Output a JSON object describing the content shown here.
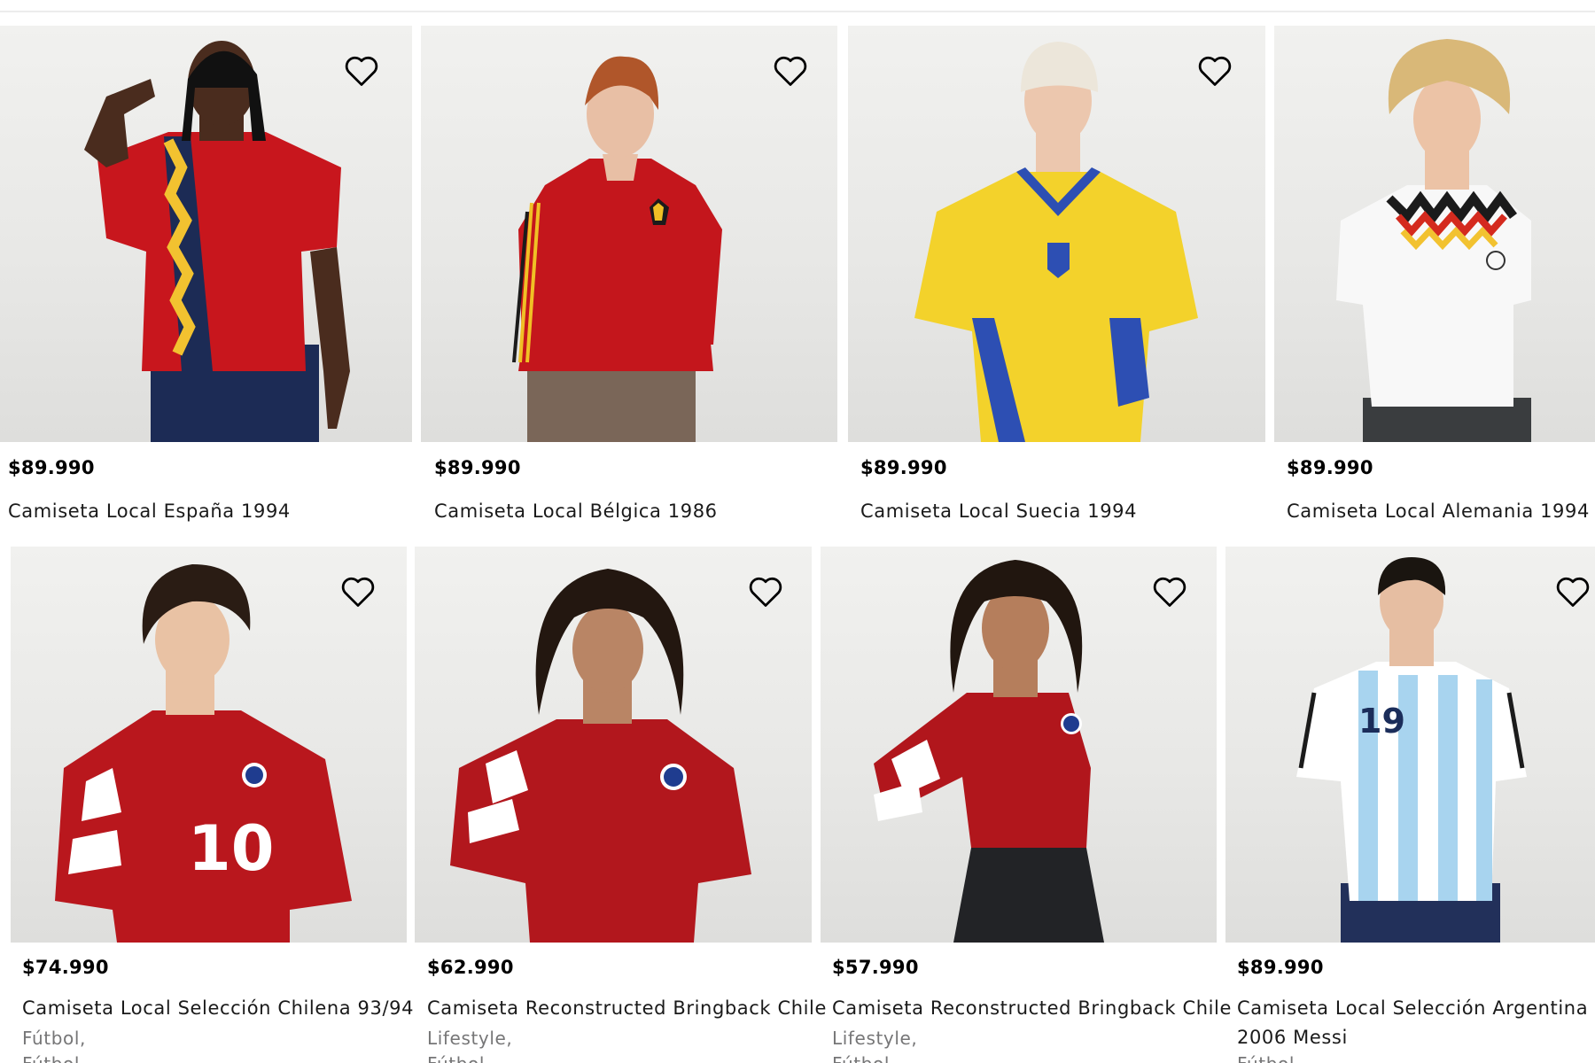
{
  "products": [
    {
      "price": "$89.990",
      "name": "Camiseta Local España 1994",
      "colors": {
        "shirt": "#c8161d",
        "accent": "#f2c230",
        "bottom": "#1c2b55",
        "skin": "#4a2c1e",
        "hair": "#111111"
      }
    },
    {
      "price": "$89.990",
      "name": "Camiseta Local Bélgica 1986",
      "colors": {
        "shirt": "#c4161c",
        "accent": "#f0c025",
        "bottom": "#7a6658",
        "skin": "#e8bfa5",
        "hair": "#b0562a"
      }
    },
    {
      "price": "$89.990",
      "name": "Camiseta Local Suecia 1994",
      "colors": {
        "shirt": "#f3d22b",
        "accent": "#2d4fb3",
        "bottom": "#f3d22b",
        "skin": "#ecc7ae",
        "hair": "#ece6da"
      }
    },
    {
      "price": "$89.990",
      "name": "Camiseta Local Alemania 1994",
      "colors": {
        "shirt": "#f8f8f8",
        "accent": "#d42a1e",
        "bottom": "#3a3d3f",
        "skin": "#ecc3a6",
        "hair": "#d9b878"
      }
    },
    {
      "price": "$74.990",
      "name": "Camiseta Local Selección Chilena 93/94",
      "category": "Fútbol,",
      "cut": "Fútbol",
      "colors": {
        "shirt": "#b9171d",
        "accent": "#ffffff",
        "bottom": "#b9171d",
        "skin": "#e9c2a4",
        "hair": "#2a1c14"
      }
    },
    {
      "price": "$62.990",
      "name": "Camiseta Reconstructed Bringback Chile",
      "category": "Lifestyle,",
      "cut": "Fútbol",
      "colors": {
        "shirt": "#b2171d",
        "accent": "#ffffff",
        "bottom": "#2a2320",
        "skin": "#b98565",
        "hair": "#231710"
      }
    },
    {
      "price": "$57.990",
      "name": "Camiseta Reconstructed Bringback Chile",
      "category": "Lifestyle,",
      "cut": "Fútbol",
      "colors": {
        "shirt": "#b1161c",
        "accent": "#ffffff",
        "bottom": "#222326",
        "skin": "#b57e5c",
        "hair": "#21160f"
      }
    },
    {
      "price": "$89.990",
      "name": "Camiseta Local Selección Argentina",
      "name2": "2006 Messi",
      "cut": "Fútbol",
      "colors": {
        "shirt": "#a8d4ef",
        "accent": "#ffffff",
        "bottom": "#22305a",
        "skin": "#e6bea2",
        "hair": "#1a1510"
      }
    }
  ]
}
